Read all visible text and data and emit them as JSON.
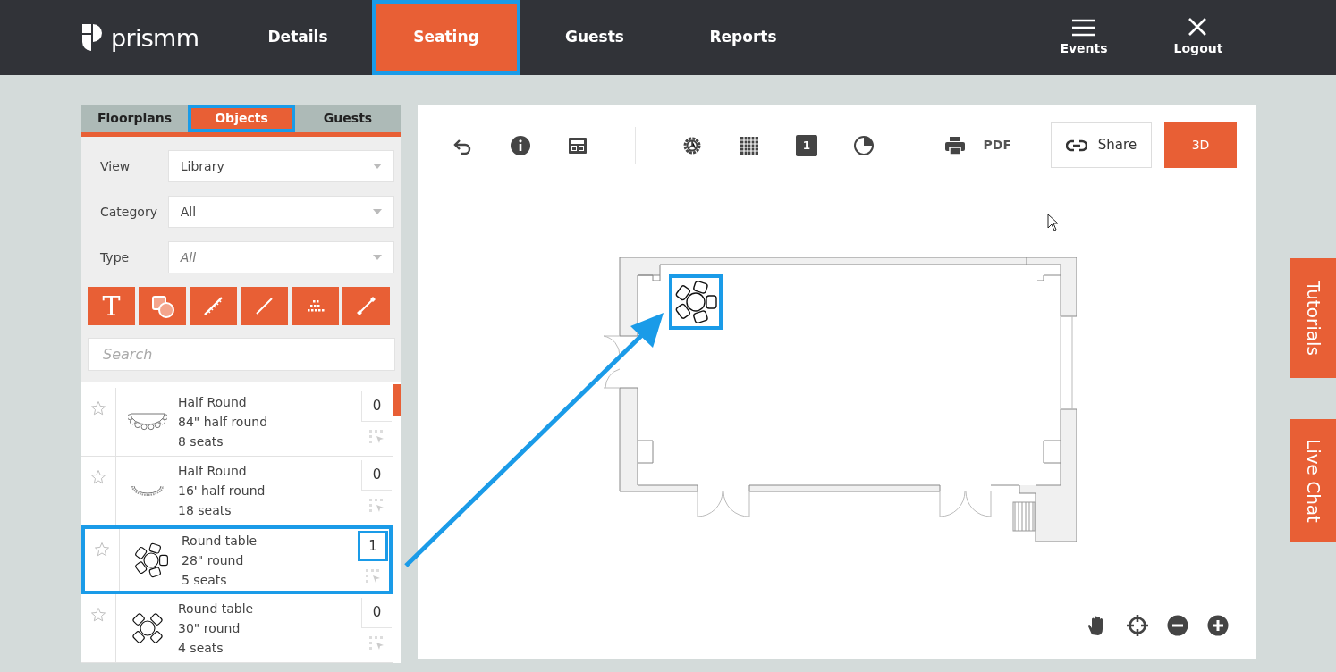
{
  "header": {
    "logo": "prismm",
    "nav": [
      {
        "label": "Details",
        "selected": false,
        "highlighted": false
      },
      {
        "label": "Seating",
        "selected": true,
        "highlighted": true
      },
      {
        "label": "Guests",
        "selected": false,
        "highlighted": false
      },
      {
        "label": "Reports",
        "selected": false,
        "highlighted": false
      }
    ],
    "actions": [
      {
        "kind": "menu",
        "label": "Events"
      },
      {
        "kind": "close",
        "label": "Logout"
      }
    ]
  },
  "panel": {
    "tabs": [
      {
        "label": "Floorplans",
        "selected": false,
        "highlighted": false
      },
      {
        "label": "Objects",
        "selected": true,
        "highlighted": true
      },
      {
        "label": "Guests",
        "selected": false,
        "highlighted": false
      }
    ],
    "filters": [
      {
        "label": "View",
        "value": "Library"
      },
      {
        "label": "Category",
        "value": "All"
      },
      {
        "label": "Type",
        "placeholder": "All"
      }
    ],
    "tools": [
      {
        "kind": "text",
        "label": "T"
      },
      {
        "kind": "shapes"
      },
      {
        "kind": "ruler"
      },
      {
        "kind": "line"
      },
      {
        "kind": "rows"
      },
      {
        "kind": "dimension"
      }
    ],
    "search": {
      "placeholder": "Search"
    },
    "objects": [
      {
        "kind": "half-round",
        "name": "Half Round",
        "size": "84\" half round",
        "seats": "8 seats",
        "count": "0",
        "starred": false,
        "highlighted": false
      },
      {
        "kind": "half-round-wide",
        "name": "Half Round",
        "size": "16' half round",
        "seats": "18 seats",
        "count": "0",
        "starred": false,
        "highlighted": false
      },
      {
        "kind": "round-5",
        "name": "Round table",
        "size": "28\" round",
        "seats": "5 seats",
        "count": "1",
        "starred": false,
        "highlighted": true
      },
      {
        "kind": "round-4",
        "name": "Round table",
        "size": "30\" round",
        "seats": "4 seats",
        "count": "0",
        "starred": false,
        "highlighted": false
      }
    ]
  },
  "canvas": {
    "toolbar": [
      {
        "kind": "undo"
      },
      {
        "kind": "info"
      },
      {
        "kind": "layout"
      },
      {
        "kind": "divider"
      },
      {
        "kind": "settings"
      },
      {
        "kind": "grid"
      },
      {
        "kind": "page",
        "label": "1"
      },
      {
        "kind": "theme"
      },
      {
        "kind": "print"
      },
      {
        "kind": "pdf",
        "label": "PDF"
      },
      {
        "kind": "share",
        "label": "Share"
      },
      {
        "kind": "view3d",
        "label": "3D"
      }
    ],
    "placed_objects": [
      {
        "kind": "round-5",
        "highlighted": true
      }
    ],
    "controls": [
      {
        "kind": "pan"
      },
      {
        "kind": "center"
      },
      {
        "kind": "zoom-out"
      },
      {
        "kind": "zoom-in"
      }
    ]
  },
  "side_tabs": [
    {
      "label": "Tutorials"
    },
    {
      "label": "Live Chat"
    }
  ]
}
